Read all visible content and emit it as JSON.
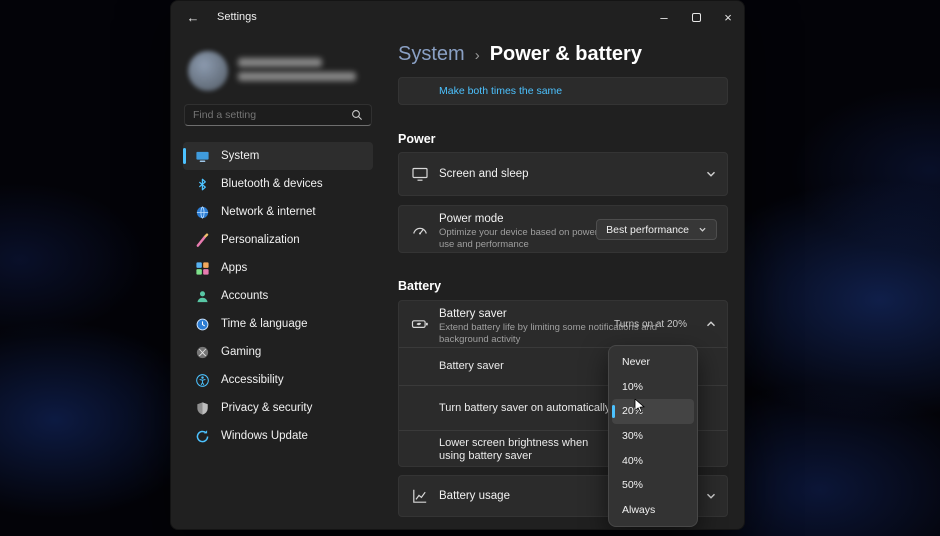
{
  "window": {
    "title": "Settings",
    "icons": {
      "back": "←",
      "minimize": "–",
      "close": "×"
    }
  },
  "sidebar": {
    "search": {
      "placeholder": "Find a setting"
    },
    "items": [
      {
        "label": "System",
        "selected": true
      },
      {
        "label": "Bluetooth & devices"
      },
      {
        "label": "Network & internet"
      },
      {
        "label": "Personalization"
      },
      {
        "label": "Apps"
      },
      {
        "label": "Accounts"
      },
      {
        "label": "Time & language"
      },
      {
        "label": "Gaming"
      },
      {
        "label": "Accessibility"
      },
      {
        "label": "Privacy & security"
      },
      {
        "label": "Windows Update"
      }
    ]
  },
  "header": {
    "breadcrumb_parent": "System",
    "breadcrumb_separator": "›",
    "page_title": "Power & battery"
  },
  "content": {
    "sync_link": "Make both times the same",
    "power": {
      "heading": "Power",
      "screen_sleep_label": "Screen and sleep",
      "power_mode_title": "Power mode",
      "power_mode_desc": "Optimize your device based on power use and performance",
      "power_mode_value": "Best performance"
    },
    "battery": {
      "heading": "Battery",
      "saver_title": "Battery saver",
      "saver_desc": "Extend battery life by limiting some notifications and background activity",
      "saver_status": "Turns on at 20%",
      "row_saver": "Battery saver",
      "row_auto": "Turn battery saver on automatically at",
      "row_brightness": "Lower screen brightness when using battery saver",
      "usage_label": "Battery usage"
    }
  },
  "menu": {
    "selected_value": "20%",
    "options": [
      {
        "label": "Never"
      },
      {
        "label": "10%"
      },
      {
        "label": "20%"
      },
      {
        "label": "30%"
      },
      {
        "label": "40%"
      },
      {
        "label": "50%"
      },
      {
        "label": "Always"
      }
    ]
  },
  "colors": {
    "accent": "#4cc2ff",
    "link": "#4cc2ff",
    "card": "#2b2b2b",
    "window": "#202020"
  }
}
